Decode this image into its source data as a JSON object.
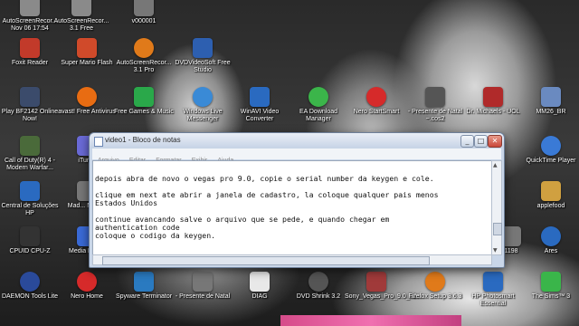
{
  "desktop": {
    "icons": [
      {
        "label": "AutoScreenRecor... Nov 06 17:54",
        "icon": "recording-reel-icon",
        "color": "#8a8a8a"
      },
      {
        "label": "AutoScreenRecor... 3.1 Free",
        "icon": "recording-reel-icon",
        "color": "#8a8a8a"
      },
      {
        "label": "v000001",
        "icon": "video-file-icon",
        "color": "#777"
      },
      {
        "label": "Foxit Reader",
        "icon": "pdf-reader-icon",
        "color": "#c23a2a"
      },
      {
        "label": "Super Mario Flash",
        "icon": "game-icon",
        "color": "#d04a2a"
      },
      {
        "label": "AutoScreenRecor... 3.1 Pro",
        "icon": "recording-reel-icon",
        "color": "#e07a1a"
      },
      {
        "label": "DVDVideoSoft Free Studio",
        "icon": "dvdvideosoft-icon",
        "color": "#2d5fb0"
      },
      {
        "label": "Play BF2142 Online Now!",
        "icon": "game-icon",
        "color": "#3b4b6b"
      },
      {
        "label": "avast! Free Antivirus",
        "icon": "antivirus-icon",
        "color": "#e86c12"
      },
      {
        "label": "Free Games & Music",
        "icon": "gift-icon",
        "color": "#2aa84a"
      },
      {
        "label": "Windows Live Messenger",
        "icon": "messenger-icon",
        "color": "#3a8ad6"
      },
      {
        "label": "WinAVI Video Converter",
        "icon": "video-converter-icon",
        "color": "#2a6ac0"
      },
      {
        "label": "EA Download Manager",
        "icon": "ea-icon",
        "color": "#3bb54a"
      },
      {
        "label": "Nero StartSmart",
        "icon": "nero-icon",
        "color": "#d62a2a"
      },
      {
        "label": "- Presente de Natal ~.cos2",
        "icon": "document-icon",
        "color": "#555"
      },
      {
        "label": "Dr. Michaels - UOL",
        "icon": "shortcut-icon",
        "color": "#b02a2a"
      },
      {
        "label": "MM26_BR",
        "icon": "app-icon",
        "color": "#6a8ac0"
      },
      {
        "label": "Call of Duty(R) 4 - Modern Warfar...",
        "icon": "game-icon",
        "color": "#4a6a3a"
      },
      {
        "label": "iTun...",
        "icon": "itunes-icon",
        "color": "#6a6ad6"
      },
      {
        "label": "QuickTime Player",
        "icon": "quicktime-icon",
        "color": "#3a7ad6"
      },
      {
        "label": "Central de Soluções HP",
        "icon": "hp-icon",
        "color": "#2a6ac0"
      },
      {
        "label": "Mad... Nord...",
        "icon": "app-icon",
        "color": "#777"
      },
      {
        "label": "applefood",
        "icon": "folder-icon",
        "color": "#d0a040"
      },
      {
        "label": "CPUID CPU-Z",
        "icon": "cpuz-icon",
        "color": "#333"
      },
      {
        "label": "Media Play...",
        "icon": "media-player-icon",
        "color": "#3a6ad6"
      },
      {
        "label": "1198",
        "icon": "document-icon",
        "color": "#777"
      },
      {
        "label": "Ares",
        "icon": "ares-icon",
        "color": "#2a6ac0"
      },
      {
        "label": "DAEMON Tools Lite",
        "icon": "daemon-tools-icon",
        "color": "#2a4a9a"
      },
      {
        "label": "Nero Home",
        "icon": "nero-icon",
        "color": "#d62a2a"
      },
      {
        "label": "Spyware Terminator",
        "icon": "spyware-icon",
        "color": "#2a7ac0"
      },
      {
        "label": "- Presente de Natal",
        "icon": "video-file-icon",
        "color": "#777"
      },
      {
        "label": "DIAG",
        "icon": "document-icon",
        "color": "#e8e8e8"
      },
      {
        "label": "DVD Shrink 3.2",
        "icon": "dvd-icon",
        "color": "#555"
      },
      {
        "label": "Sony_Vegas_Pro_9.0_32...",
        "icon": "archive-icon",
        "color": "#a03a3a"
      },
      {
        "label": "Firefox Setup 3.6.3",
        "icon": "firefox-icon",
        "color": "#e07a1a"
      },
      {
        "label": "HP Photosmart Essential",
        "icon": "hp-icon",
        "color": "#2a6ac0"
      },
      {
        "label": "The Sims™ 3",
        "icon": "sims-icon",
        "color": "#3ab54a"
      }
    ]
  },
  "notepad": {
    "title": "video1 - Bloco de notas",
    "menu": [
      "Arquivo",
      "Editar",
      "Formatar",
      "Exibir",
      "Ajuda"
    ],
    "lines": [
      "depois abra de novo o vegas pro 9.0, copie o serial number da keygen e cole.",
      "",
      "clique em next ate abrir a janela de cadastro, la coloque qualquer pais menos",
      "Estados Unidos",
      "",
      "continue avancando salve o arquivo que se pede, e quando chegar em",
      "authentication code",
      "coloque o codigo da keygen."
    ],
    "buttons": {
      "minimize": "_",
      "maximize": "□",
      "close": "✕"
    }
  }
}
